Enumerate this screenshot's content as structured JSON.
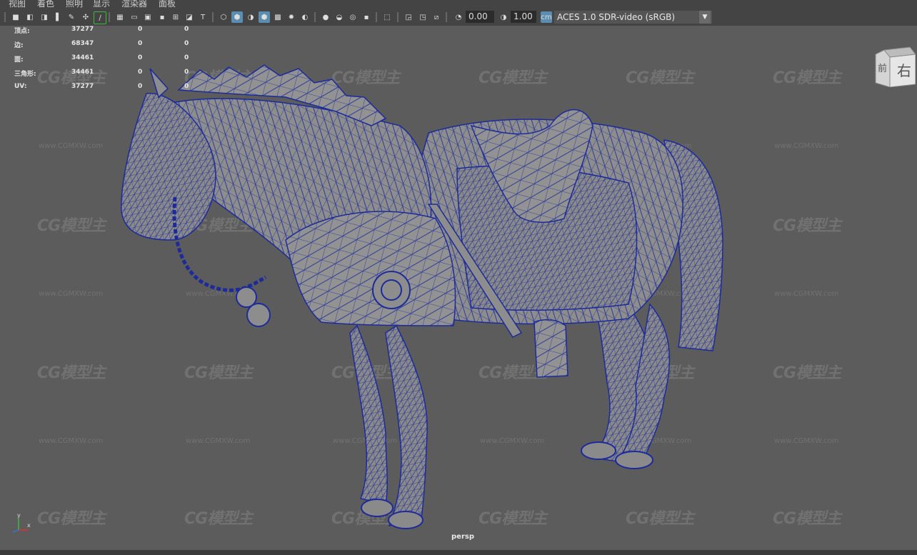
{
  "menu": [
    "视图",
    "着色",
    "照明",
    "显示",
    "渲染器",
    "面板"
  ],
  "toolbar": {
    "exposure": "0.00",
    "gamma": "1.00",
    "color_space": "ACES 1.0 SDR-video (sRGB)",
    "exposure_icon": "exposure-icon",
    "gamma_icon": "gamma-icon"
  },
  "hud": {
    "rows": [
      {
        "label": "顶点:",
        "v1": "37277",
        "v2": "0",
        "v3": "0"
      },
      {
        "label": "边:",
        "v1": "68347",
        "v2": "0",
        "v3": "0"
      },
      {
        "label": "面:",
        "v1": "34461",
        "v2": "0",
        "v3": "0"
      },
      {
        "label": "三角形:",
        "v1": "34461",
        "v2": "0",
        "v3": "0"
      },
      {
        "label": "UV:",
        "v1": "37277",
        "v2": "0",
        "v3": "0"
      }
    ]
  },
  "viewcube": {
    "front": "前",
    "right": "右"
  },
  "camera_label": "persp",
  "axis": {
    "y": "y",
    "x": "x"
  },
  "watermark": {
    "logo": "CG模型主",
    "url": "www.CGMXW.com"
  },
  "colors": {
    "wire": "#1d2b9a",
    "mesh": "#8a8a8a",
    "bg": "#5c5c5c"
  }
}
